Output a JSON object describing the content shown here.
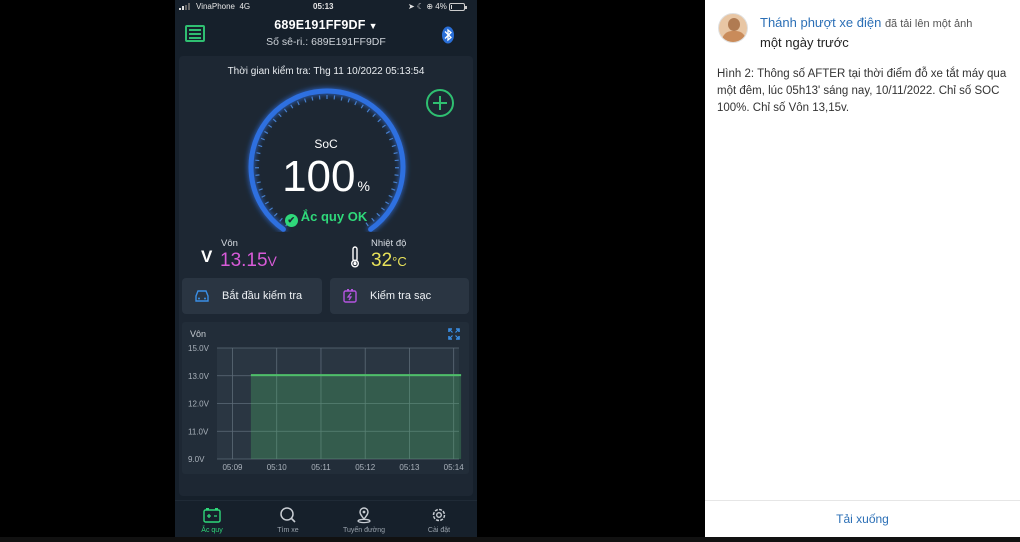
{
  "status_bar": {
    "carrier": "VinaPhone",
    "network": "4G",
    "time": "05:13",
    "battery_percent": "4%",
    "battery_level": 0.04
  },
  "header": {
    "device_name": "689E191FF9DF",
    "serial": "Số sê-ri.: 689E191FF9DF"
  },
  "check_time": "Thời gian kiểm tra: Thg 11 10/2022 05:13:54",
  "gauge": {
    "label": "SoC",
    "value": "100",
    "unit": "%",
    "level": 1.0,
    "status": "Ắc quy OK",
    "colors": {
      "arc": "#2f6fe0",
      "glow": "#5aa0ff",
      "ok": "#2fd87a"
    }
  },
  "voltage": {
    "label": "Vôn",
    "value": "13.15",
    "unit": "V",
    "color": "#d85bd8"
  },
  "temperature": {
    "label": "Nhiệt độ",
    "value": "32",
    "unit": "°C",
    "color": "#e8e25a"
  },
  "actions": {
    "start_test": "Bắt đầu kiểm tra",
    "charge_test": "Kiểm tra sạc"
  },
  "chart_data": {
    "type": "area",
    "title": "",
    "ylabel": "Vôn",
    "xlabel": "",
    "y_ticks": [
      "15.0V",
      "13.0V",
      "12.0V",
      "11.0V",
      "9.0V"
    ],
    "x_ticks": [
      "05:09",
      "05:10",
      "05:11",
      "05:12",
      "05:13",
      "05:14"
    ],
    "grid": true,
    "series": [
      {
        "x": [
          "05:09:25",
          "05:14:10"
        ],
        "values": [
          13.05,
          13.05
        ],
        "color": "#4fbf6a"
      }
    ]
  },
  "tabs": [
    {
      "label": "Ắc quy",
      "icon": "battery-icon",
      "active": true
    },
    {
      "label": "Tìm xe",
      "icon": "search-icon",
      "active": false
    },
    {
      "label": "Tuyến đường",
      "icon": "route-pin-icon",
      "active": false
    },
    {
      "label": "Cài đặt",
      "icon": "gear-icon",
      "active": false
    }
  ],
  "post": {
    "author": "Thánh phượt xe điện",
    "action": "đã tải lên một ảnh",
    "time_ago": "một ngày trước",
    "caption": "Hình 2: Thông số AFTER tại thời điểm đỗ xe tắt máy qua một đêm, lúc 05h13' sáng nay, 10/11/2022. Chỉ số SOC 100%. Chỉ số Vôn 13,15v.",
    "download_label": "Tải xuống"
  }
}
